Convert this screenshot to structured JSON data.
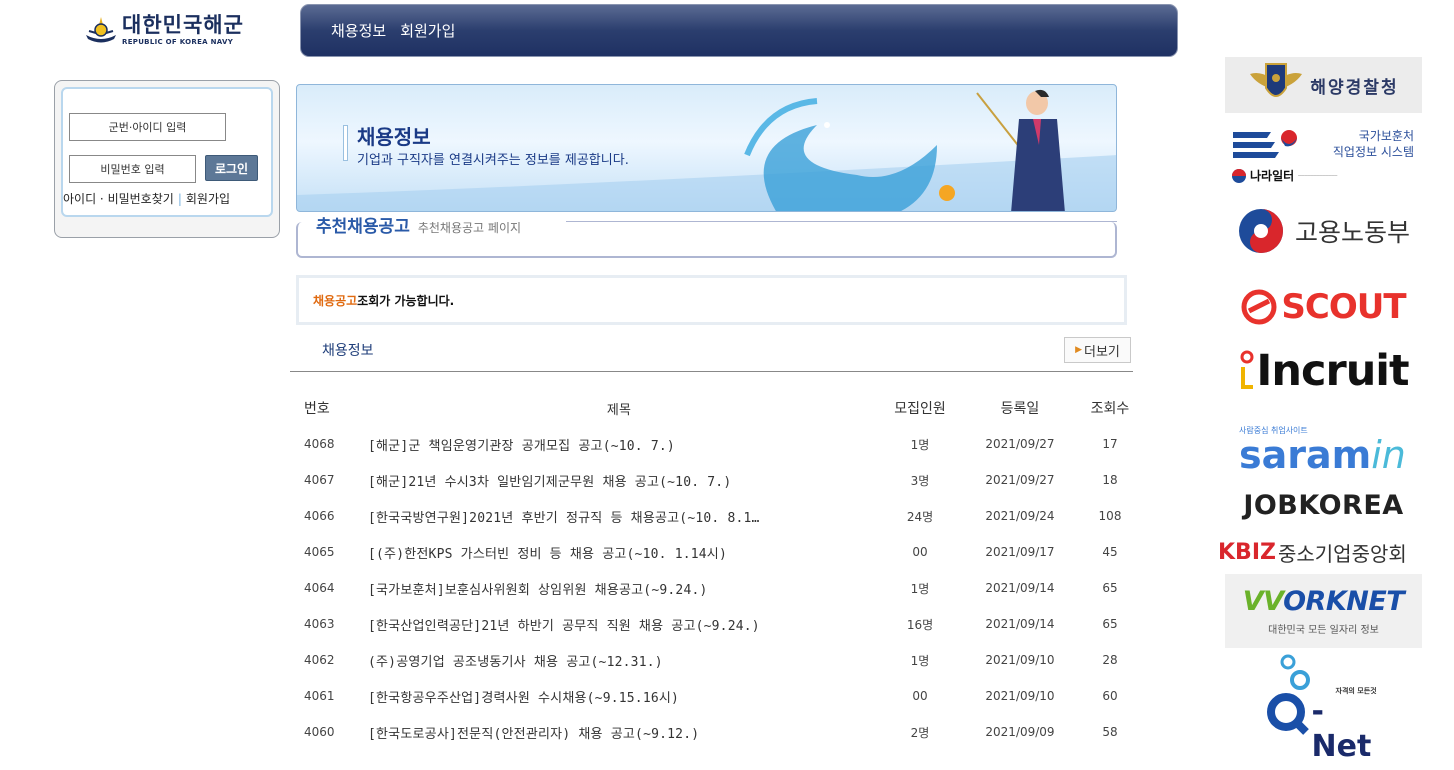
{
  "logo": {
    "name_kr": "대한민국해군",
    "name_en": "REPUBLIC OF KOREA NAVY"
  },
  "topnav": {
    "items": [
      "채용정보",
      "회원가입"
    ]
  },
  "login": {
    "id_placeholder": "군번·아이디 입력",
    "pw_placeholder": "비밀번호 입력",
    "login_button": "로그인",
    "find_link": "아이디 · 비밀번호찾기",
    "join_link": "회원가입"
  },
  "banner": {
    "title": "채용정보",
    "subtitle": "기업과 구직자를 연결시켜주는 정보를 제공합니다."
  },
  "section": {
    "title": "추천채용공고",
    "subtitle": "추천채용공고 페이지"
  },
  "notice": {
    "highlight": "채용공고",
    "text": " 조회가 가능합니다."
  },
  "list": {
    "title": "채용정보",
    "more": "더보기",
    "columns": [
      "번호",
      "제목",
      "모집인원",
      "등록일",
      "조회수"
    ],
    "rows": [
      {
        "no": "4068",
        "title": "[해군]군 책임운영기관장 공개모집 공고(~10. 7.)",
        "count": "1명",
        "date": "2021/09/27",
        "views": "17"
      },
      {
        "no": "4067",
        "title": "[해군]21년 수시3차 일반임기제군무원 채용 공고(~10. 7.)",
        "count": "3명",
        "date": "2021/09/27",
        "views": "18"
      },
      {
        "no": "4066",
        "title": "[한국국방연구원]2021년 후반기 정규직 등 채용공고(~10. 8.1…",
        "count": "24명",
        "date": "2021/09/24",
        "views": "108"
      },
      {
        "no": "4065",
        "title": "[(주)한전KPS 가스터빈 정비 등 채용 공고(~10. 1.14시)",
        "count": "00",
        "date": "2021/09/17",
        "views": "45"
      },
      {
        "no": "4064",
        "title": "[국가보훈처]보훈심사위원회 상임위원 채용공고(~9.24.)",
        "count": "1명",
        "date": "2021/09/14",
        "views": "65"
      },
      {
        "no": "4063",
        "title": "[한국산업인력공단]21년 하반기 공무직 직원 채용 공고(~9.24.)",
        "count": "16명",
        "date": "2021/09/14",
        "views": "65"
      },
      {
        "no": "4062",
        "title": "(주)공영기업 공조냉동기사 채용 공고(~12.31.)",
        "count": "1명",
        "date": "2021/09/10",
        "views": "28"
      },
      {
        "no": "4061",
        "title": "[한국항공우주산업]경력사원 수시채용(~9.15.16시)",
        "count": "00",
        "date": "2021/09/10",
        "views": "60"
      },
      {
        "no": "4060",
        "title": "[한국도로공사]전문직(안전관리자) 채용 공고(~9.12.)",
        "count": "2명",
        "date": "2021/09/09",
        "views": "58"
      }
    ]
  },
  "sidebar": {
    "coast_guard": "해양경찰청",
    "mpva_line1": "국가보훈처",
    "mpva_line2": "직업정보 시스템",
    "mpva_nara": "나라일터",
    "moel": "고용노동부",
    "scout": "SCOUT",
    "incruit": "Incruit",
    "saram_small": "사람중심 취업사이트",
    "saram_a": "saram",
    "saram_b": "in",
    "jobkorea": "JOBKOREA",
    "kbiz_k": "KBIZ",
    "kbiz_t": "중소기업중앙회",
    "worknet": "ORKNET",
    "worknet_sub": "대한민국 모든 일자리 정보",
    "qnet": "-Net",
    "qnet_cap": "자격의 모든것"
  }
}
